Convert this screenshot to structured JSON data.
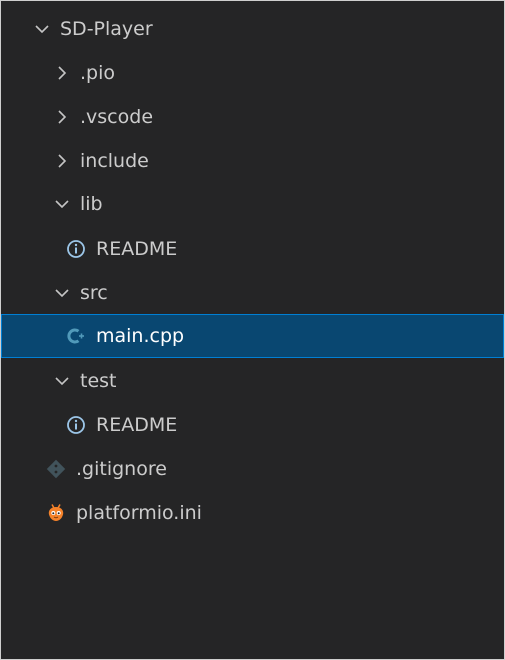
{
  "explorer": {
    "root": {
      "label": "SD-Player",
      "expanded": true
    },
    "items": [
      {
        "label": ".pio",
        "type": "folder",
        "expanded": false
      },
      {
        "label": ".vscode",
        "type": "folder",
        "expanded": false
      },
      {
        "label": "include",
        "type": "folder",
        "expanded": false
      },
      {
        "label": "lib",
        "type": "folder",
        "expanded": true
      },
      {
        "label": "README",
        "type": "file",
        "icon": "info-icon"
      },
      {
        "label": "src",
        "type": "folder",
        "expanded": true
      },
      {
        "label": "main.cpp",
        "type": "file",
        "icon": "cpp-icon",
        "selected": true
      },
      {
        "label": "test",
        "type": "folder",
        "expanded": true
      },
      {
        "label": "README",
        "type": "file",
        "icon": "info-icon"
      },
      {
        "label": ".gitignore",
        "type": "file",
        "icon": "git-icon"
      },
      {
        "label": "platformio.ini",
        "type": "file",
        "icon": "platformio-icon"
      }
    ]
  },
  "colors": {
    "background": "#252526",
    "selection": "#094771",
    "selection_border": "#007fd4",
    "text": "#cccccc",
    "cpp_icon": "#519aba",
    "platformio_icon": "#f5822a"
  }
}
